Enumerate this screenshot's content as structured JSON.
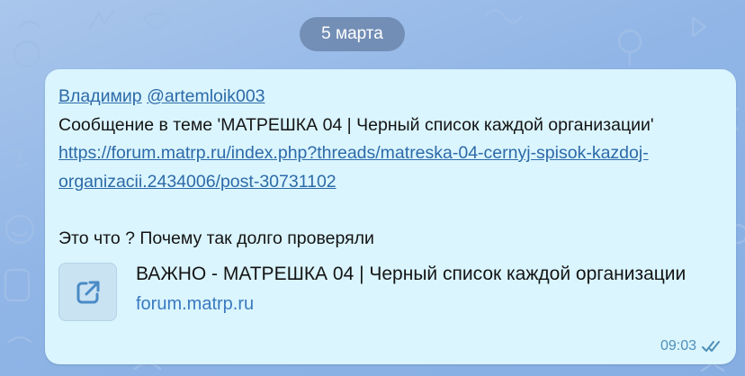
{
  "date_label": "5 марта",
  "message": {
    "author_name": "Владимир",
    "author_handle": "@artemloik003",
    "text_line": "Сообщение в теме 'МАТРЕШКА 04 |  Черный список каждой организации'",
    "link_line_1": "https://forum.matrp.ru/index.php?threads/matreska-04-cernyj-spisok-kazdoj-",
    "link_line_2": "organizacii.2434006/post-30731102",
    "question": "Это что ? Почему так долго проверяли",
    "time": "09:03",
    "read_status": "double-check-icon"
  },
  "link_preview": {
    "title": "ВАЖНО - МАТРЕШКА 04 | Черный список каждой организации",
    "domain": "forum.matrp.ru",
    "icon": "external-link-icon"
  },
  "colors": {
    "bubble": "#daf5fe",
    "link": "#2d6aa8",
    "accent": "#3a7abf",
    "time": "#4f8fb8",
    "date_pill": "#5a7396"
  }
}
